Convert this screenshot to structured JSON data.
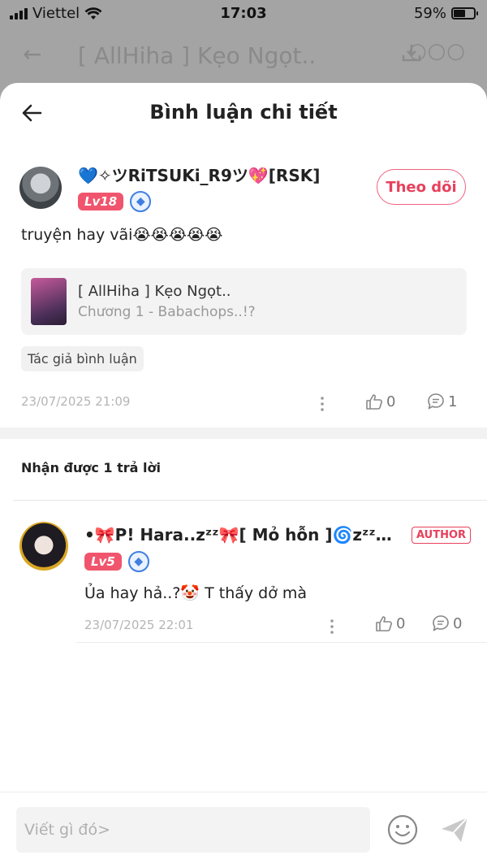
{
  "status_bar": {
    "carrier": "Viettel",
    "time": "17:03",
    "battery": "59%"
  },
  "background_page": {
    "title": "[ AllHiha ] Kẹo Ngọt.."
  },
  "sheet": {
    "title": "Bình luận chi tiết"
  },
  "comment": {
    "username": "💙✧ツRiTSUKi_R9ツ💖[RSK]",
    "level": "Lv18",
    "follow_label": "Theo dõi",
    "text": "truyện hay vãi😭😭😭😭😭",
    "story": {
      "title": "[ AllHiha ] Kẹo Ngọt..",
      "chapter": "Chương 1 - Babachops..!?"
    },
    "author_tag": "Tác giả bình luận",
    "timestamp": "23/07/2025 21:09",
    "likes": "0",
    "replies": "1"
  },
  "replies_section": {
    "label": "Nhận được 1 trả lời"
  },
  "reply": {
    "username": "•🎀P! Hara..zᶻᶻ🎀[ Mỏ hỗn ]🌀zᶻᶻ…",
    "author_badge": "AUTHOR",
    "level": "Lv5",
    "text": "Ủa hay hả..?🤡 T thấy dở mà",
    "timestamp": "23/07/2025 22:01",
    "likes": "0",
    "replies": "0"
  },
  "composer": {
    "placeholder": "Viết gì đó>"
  },
  "colors": {
    "accent": "#e8405c",
    "level_badge": "#f0556d",
    "vip_blue": "#3f7fe0"
  }
}
